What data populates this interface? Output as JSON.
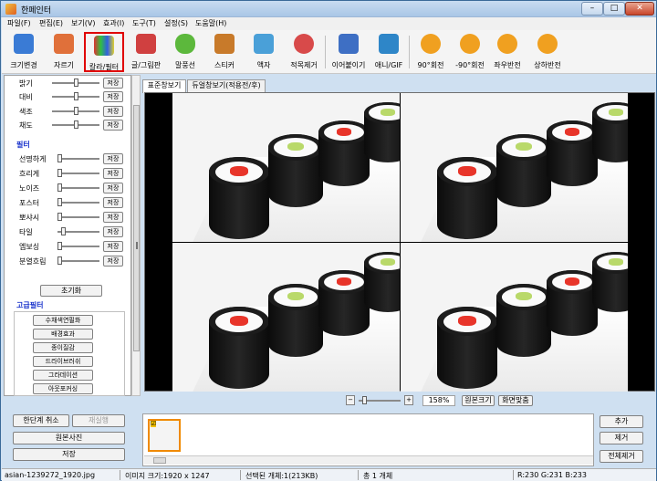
{
  "window": {
    "title": "한페인터"
  },
  "menu": [
    "파일(F)",
    "편집(E)",
    "보기(V)",
    "효과(I)",
    "도구(T)",
    "설정(S)",
    "도움말(H)"
  ],
  "toolbar": [
    {
      "label": "크기변경",
      "icon": "resize-icon"
    },
    {
      "label": "자르기",
      "icon": "crop-icon"
    },
    {
      "label": "칼라/필터",
      "icon": "color-filter-icon"
    },
    {
      "label": "글/그림판",
      "icon": "text-drawing-icon"
    },
    {
      "label": "말풍선",
      "icon": "speech-bubble-icon"
    },
    {
      "label": "스티커",
      "icon": "sticker-icon"
    },
    {
      "label": "액자",
      "icon": "frame-icon"
    },
    {
      "label": "적목제거",
      "icon": "red-eye-icon"
    },
    {
      "label": "이어붙이기",
      "icon": "merge-icon"
    },
    {
      "label": "애니/GIF",
      "icon": "animation-gif-icon"
    },
    {
      "label": "90°회전",
      "icon": "rotate-90-icon"
    },
    {
      "label": "-90°회전",
      "icon": "rotate-minus-90-icon"
    },
    {
      "label": "좌우반전",
      "icon": "flip-horizontal-icon"
    },
    {
      "label": "상하반전",
      "icon": "flip-vertical-icon"
    }
  ],
  "adjust": [
    {
      "label": "밝기",
      "value": 0.5
    },
    {
      "label": "대비",
      "value": 0.5
    },
    {
      "label": "색조",
      "value": 0.5
    },
    {
      "label": "채도",
      "value": 0.5
    }
  ],
  "save_label": "저장",
  "filter": {
    "title": "필터",
    "items": [
      {
        "label": "선명하게",
        "value": 0.0
      },
      {
        "label": "흐리게",
        "value": 0.0
      },
      {
        "label": "노이즈",
        "value": 0.0
      },
      {
        "label": "포스터",
        "value": 0.0
      },
      {
        "label": "뽀샤시",
        "value": 0.0
      },
      {
        "label": "타일",
        "value": 0.1
      },
      {
        "label": "엠보싱",
        "value": 0.0
      },
      {
        "label": "분열흐림",
        "value": 0.0
      }
    ]
  },
  "reset_label": "초기화",
  "advanced": {
    "title": "고급필터",
    "items": [
      "수채색연필화",
      "배경효과",
      "종이질감",
      "드라이브러쉬",
      "그라데이션",
      "아웃포커싱"
    ]
  },
  "tabs": [
    "표준창보기",
    "듀얼창보기(적용전/후)"
  ],
  "zoom": {
    "value": "158%",
    "fit_label": "원본크기",
    "screen_label": "화면맞춤",
    "level": 0.1
  },
  "history": {
    "undo_label": "한단계 취소",
    "redo_label": "재실행",
    "original_label": "원본사진",
    "save_label": "저장"
  },
  "list_buttons": {
    "add": "추가",
    "remove": "제거",
    "remove_all": "전체제거"
  },
  "status": {
    "filename": "asian-1239272_1920.jpg",
    "size": "이미지 크기:1920 x 1247",
    "selected": "선택된 개체:1(213KB)",
    "total": "총 1 개체",
    "rgb": "R:230 G:231 B:233"
  },
  "colors": {
    "highlight": "#e00000",
    "section_title": "#1a33cc",
    "thumb_border": "#f08a00"
  }
}
